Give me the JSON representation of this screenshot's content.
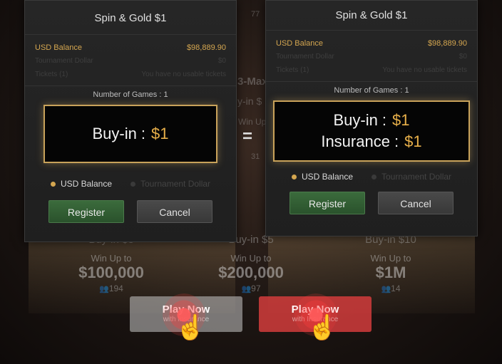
{
  "left_dialog": {
    "title": "Spin & Gold $1",
    "usd_balance_label": "USD Balance",
    "usd_balance_value": "$98,889.90",
    "tournament_dollar_label": "Tournament Dollar",
    "tournament_dollar_value": "$0",
    "tickets_label": "Tickets (1)",
    "tickets_value": "You have no usable tickets",
    "games_label": "Number of Games",
    "games_value": "1",
    "buyin_label": "Buy-in :",
    "buyin_value": "$1",
    "radio_usd": "USD Balance",
    "radio_td": "Tournament Dollar",
    "register": "Register",
    "cancel": "Cancel"
  },
  "right_dialog": {
    "title": "Spin & Gold $1",
    "usd_balance_label": "USD Balance",
    "usd_balance_value": "$98,889.90",
    "tournament_dollar_label": "Tournament Dollar",
    "tournament_dollar_value": "$0",
    "tickets_label": "Tickets (1)",
    "tickets_value": "You have no usable tickets",
    "games_label": "Number of Games",
    "games_value": "1",
    "buyin_label": "Buy-in :",
    "buyin_value": "$1",
    "insurance_label": "Insurance :",
    "insurance_value": "$1",
    "radio_usd": "USD Balance",
    "radio_td": "Tournament Dollar",
    "register": "Register",
    "cancel": "Cancel"
  },
  "equals": "=",
  "lobby_tiles": [
    {
      "buyin": "Buy-in $3",
      "winup": "Win Up to",
      "prize": "$100,000",
      "count": "194"
    },
    {
      "buyin": "Buy-in $5",
      "winup": "Win Up to",
      "prize": "$200,000",
      "count": "97"
    },
    {
      "buyin": "Buy-in $10",
      "winup": "Win Up to",
      "prize": "$1M",
      "count": "14"
    }
  ],
  "bg_text": {
    "max": "3-Max",
    "buyin": "y-in $",
    "winup": "Win Up",
    "count_top": "77",
    "count_mid": "31"
  },
  "play_left": {
    "label": "Play Now",
    "sub": "with Insurance"
  },
  "play_right": {
    "label": "Play Now",
    "sub": "with Insurance"
  },
  "colors": {
    "gold": "#d4a650",
    "register_green": "#3b6b3c",
    "play_red": "#d23c3c"
  }
}
